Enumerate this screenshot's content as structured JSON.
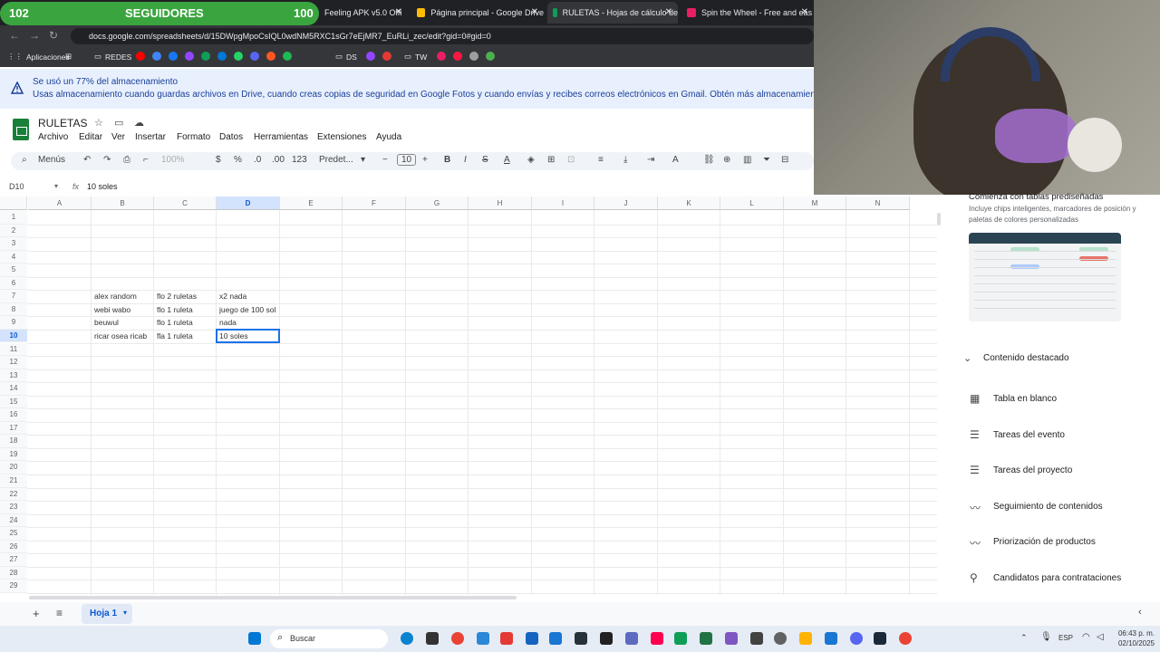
{
  "overlay": {
    "level_left": "102",
    "label": "SEGUIDORES",
    "level_right": "100"
  },
  "tabs": [
    {
      "title": "Feeling APK v5.0 Offi",
      "color": "#555"
    },
    {
      "title": "Página principal - Google Drive",
      "color": "#fbbc04"
    },
    {
      "title": "RULETAS - Hojas de cálculo de",
      "color": "#0f9d58"
    },
    {
      "title": "Spin the Wheel - Free and eas",
      "color": "#e91e63"
    }
  ],
  "address": {
    "url": "docs.google.com/spreadsheets/d/15DWpgMpoCsIQL0wdNM5RXC1sGr7eEjMR7_EuRLi_zec/edit?gid=0#gid=0"
  },
  "bookmarks": {
    "apps": "Aplicaciones",
    "redes": "REDES",
    "ds": "DS",
    "tw": "TW"
  },
  "banner": {
    "title": "Se usó un 77% del almacenamiento",
    "body": "Usas almacenamiento cuando guardas archivos en Drive, cuando creas copias de seguridad en Google Fotos y cuando envías y recibes correos electrónicos en Gmail. Obtén más almacenamiento —"
  },
  "doc": {
    "title": "RULETAS",
    "menus": [
      "Archivo",
      "Editar",
      "Ver",
      "Insertar",
      "Formato",
      "Datos",
      "Herramientas",
      "Extensiones",
      "Ayuda"
    ]
  },
  "toolbar": {
    "menus": "Menús",
    "zoom": "100%",
    "currency": "$",
    "percent": "%",
    "dec_less": ".0",
    "dec_more": ".00",
    "number": "123",
    "font": "Predet...",
    "font_size": "10"
  },
  "formula": {
    "namebox": "D10",
    "fx": "fx",
    "value": "10 soles"
  },
  "grid": {
    "columns": [
      "A",
      "B",
      "C",
      "D",
      "E",
      "F",
      "G",
      "H",
      "I",
      "J",
      "K",
      "L",
      "M",
      "N"
    ],
    "selected_column": "D",
    "rows": [
      "1",
      "2",
      "3",
      "4",
      "5",
      "6",
      "7",
      "8",
      "9",
      "10",
      "11",
      "12",
      "13",
      "14",
      "15",
      "16",
      "17",
      "18",
      "19",
      "20",
      "21",
      "22",
      "23",
      "24",
      "25",
      "26",
      "27",
      "28",
      "29"
    ],
    "selected_row": "10",
    "data": [
      {
        "row": 7,
        "B": "alex random",
        "C": "flo 2 ruletas",
        "D": "x2 nada"
      },
      {
        "row": 8,
        "B": "webi wabo",
        "C": "flo 1 ruleta",
        "D": "juego de 100 sol"
      },
      {
        "row": 9,
        "B": "beuwul",
        "C": "flo 1 ruleta",
        "D": "nada"
      },
      {
        "row": 10,
        "B": "ricar osea ricab",
        "C": "fla 1 ruleta",
        "D": "10 soles"
      }
    ]
  },
  "sheets": {
    "active": "Hoja 1"
  },
  "side_panel": {
    "heading": "Comienza con tablas prediseñadas",
    "sub": "Incluye chips inteligentes, marcadores de posición y paletas de colores personalizadas",
    "section": "Contenido destacado",
    "items": [
      {
        "label": "Tabla en blanco",
        "icon": "table-icon"
      },
      {
        "label": "Tareas del evento",
        "icon": "checklist-icon"
      },
      {
        "label": "Tareas del proyecto",
        "icon": "checklist-icon"
      },
      {
        "label": "Seguimiento de contenidos",
        "icon": "trend-icon"
      },
      {
        "label": "Priorización de productos",
        "icon": "trend-icon"
      },
      {
        "label": "Candidatos para contrataciones",
        "icon": "person-icon"
      }
    ]
  },
  "taskbar": {
    "search": "Buscar",
    "lang": "ESP",
    "time": "06:43 p. m.",
    "date": "02/10/2025"
  }
}
